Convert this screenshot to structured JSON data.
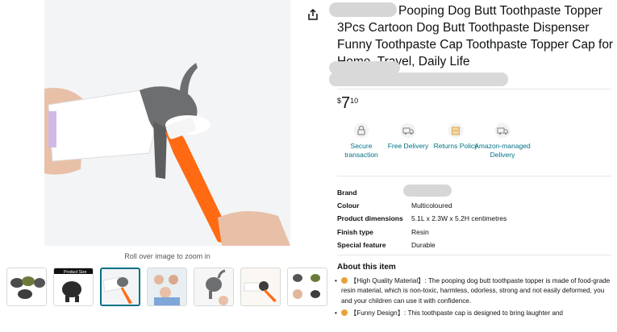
{
  "product": {
    "title": "Pooping Dog Butt Toothpaste Topper 3Pcs Cartoon Dog Butt Toothpaste Dispenser Funny Toothpaste Cap Toothpaste Topper Cap for Home, Travel, Daily Life",
    "zoom_hint": "Roll over image to zoom in",
    "thumbnails": [
      "thumb-1",
      "thumb-2",
      "thumb-3",
      "thumb-4",
      "thumb-5",
      "thumb-6",
      "thumb-7"
    ],
    "thumb_product_size_label": "Product Size",
    "selected_thumbnail": 3
  },
  "price": {
    "symbol": "$",
    "whole": "7",
    "fraction": "10"
  },
  "features": [
    {
      "icon": "lock-icon",
      "label": "Secure transaction"
    },
    {
      "icon": "truck-icon",
      "label": "Free Delivery"
    },
    {
      "icon": "returns-icon",
      "label": "Returns Policy"
    },
    {
      "icon": "amazon-truck-icon",
      "label": "Amazon-managed Delivery"
    }
  ],
  "specs": [
    {
      "key": "Brand",
      "value": ""
    },
    {
      "key": "Colour",
      "value": "Multicoloured"
    },
    {
      "key": "Product dimensions",
      "value": "5.1L x 2.3W x 5.2H centimetres"
    },
    {
      "key": "Finish type",
      "value": "Resin"
    },
    {
      "key": "Special feature",
      "value": "Durable"
    }
  ],
  "about": {
    "title": "About this item",
    "bullets": [
      "【High Quality Material】: The pooping dog butt toothpaste topper is made of food-grade resin material, which is non-toxic, harmless, odorless, strong and not easily deformed, you and your children can use it with confidence.",
      "【Funny Design】: This toothpaste cap is designed to bring laughter and"
    ]
  },
  "colors": {
    "link": "#007185",
    "selected_border": "#007185",
    "toothbrush": "#ff6a13",
    "topper": "#6d6e70"
  }
}
